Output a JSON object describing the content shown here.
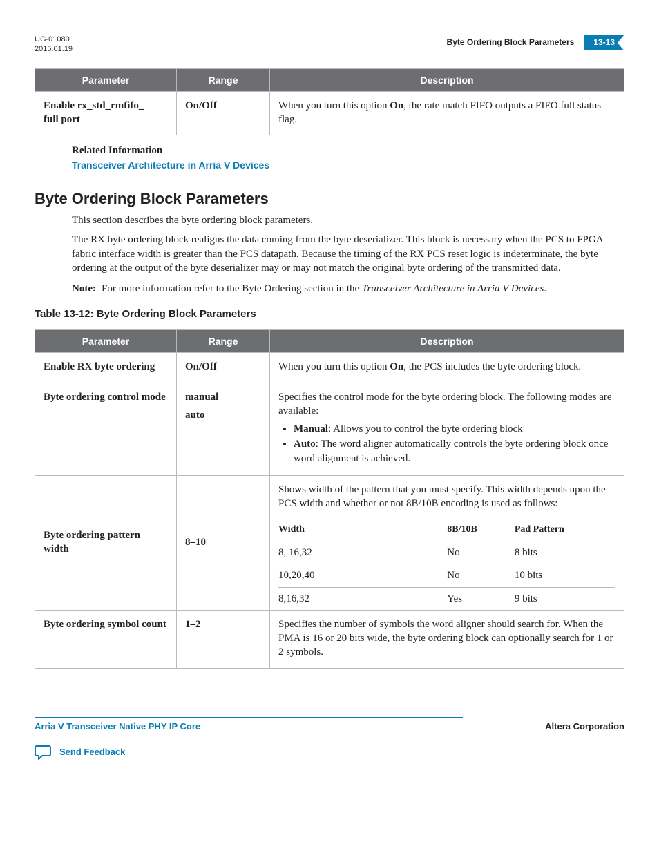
{
  "header": {
    "doc_id": "UG-01080",
    "date": "2015.01.19",
    "section_title": "Byte Ordering Block Parameters",
    "page_number": "13-13"
  },
  "table1": {
    "headers": [
      "Parameter",
      "Range",
      "Description"
    ],
    "rows": [
      {
        "param": "Enable rx_std_rmfifo_\nfull port",
        "range": "On/Off",
        "desc_pre": "When you turn this option ",
        "desc_strong": "On",
        "desc_post": ", the rate match FIFO outputs a FIFO full status flag."
      }
    ]
  },
  "related": {
    "label": "Related Information",
    "link_text": "Transceiver Architecture in Arria V Devices"
  },
  "section": {
    "heading": "Byte Ordering Block Parameters",
    "para1": "This section describes the byte ordering block parameters.",
    "para2": "The RX byte ordering block realigns the data coming from the byte deserializer. This block is necessary when the PCS to FPGA fabric interface width is greater than the PCS datapath. Because the timing of the RX PCS reset logic is indeterminate, the byte ordering at the output of the byte deserializer may or may not match the original byte ordering of the transmitted data.",
    "note_label": "Note:",
    "note_pre": "For more information refer to the Byte Ordering section in the ",
    "note_it": "Transceiver Architecture in Arria V Devices",
    "note_post": "."
  },
  "table2_caption": "Table 13-12: Byte Ordering Block Parameters",
  "table2": {
    "headers": [
      "Parameter",
      "Range",
      "Description"
    ],
    "row_enable": {
      "param": "Enable RX byte ordering",
      "range": "On/Off",
      "desc_pre": "When you turn this option ",
      "desc_strong": "On",
      "desc_post": ", the PCS includes the byte ordering block."
    },
    "row_ctrl": {
      "param": "Byte ordering control mode",
      "range_items": [
        "manual",
        "auto"
      ],
      "desc_intro": "Specifies the control mode for the byte ordering block. The following modes are available:",
      "bullets": [
        {
          "strong": "Manual",
          "text": ": Allows you to control the byte ordering block"
        },
        {
          "strong": "Auto",
          "text": ": The word aligner automatically controls the byte ordering block once word alignment is achieved."
        }
      ]
    },
    "row_width": {
      "param": "Byte ordering pattern width",
      "range": "8–10",
      "desc_intro": "Shows width of the pattern that you must specify. This width depends upon the PCS width and whether or not 8B/10B encoding is used as follows:",
      "inner_headers": [
        "Width",
        "8B/10B",
        "Pad Pattern"
      ],
      "inner_rows": [
        [
          "8, 16,32",
          "No",
          "8 bits"
        ],
        [
          "10,20,40",
          "No",
          "10 bits"
        ],
        [
          "8,16,32",
          "Yes",
          "9 bits"
        ]
      ]
    },
    "row_sym": {
      "param": "Byte ordering symbol count",
      "range": "1–2",
      "desc": "Specifies the number of symbols the word aligner should search for. When the PMA is 16 or 20 bits wide, the byte ordering block can optionally search for 1 or 2 symbols."
    }
  },
  "footer": {
    "left": "Arria V Transceiver Native PHY IP Core",
    "right": "Altera Corporation",
    "feedback": "Send Feedback"
  },
  "chart_data": {
    "type": "table",
    "title": "Table 13-12: Byte Ordering Block Parameters",
    "columns": [
      "Parameter",
      "Range",
      "Description"
    ],
    "rows": [
      [
        "Enable RX byte ordering",
        "On/Off",
        "When you turn this option On, the PCS includes the byte ordering block."
      ],
      [
        "Byte ordering control mode",
        "manual / auto",
        "Specifies the control mode for the byte ordering block. Manual: allows you to control the byte ordering block. Auto: the word aligner automatically controls the byte ordering block once word alignment is achieved."
      ],
      [
        "Byte ordering pattern width",
        "8–10",
        "Shows width of the pattern that you must specify, depending on PCS width and 8B/10B encoding. Width 8,16,32 with 8B/10B=No → Pad Pattern 8 bits; Width 10,20,40 with 8B/10B=No → 10 bits; Width 8,16,32 with 8B/10B=Yes → 9 bits."
      ],
      [
        "Byte ordering symbol count",
        "1–2",
        "Specifies the number of symbols the word aligner should search for. When the PMA is 16 or 20 bits wide, the byte ordering block can optionally search for 1 or 2 symbols."
      ]
    ]
  }
}
